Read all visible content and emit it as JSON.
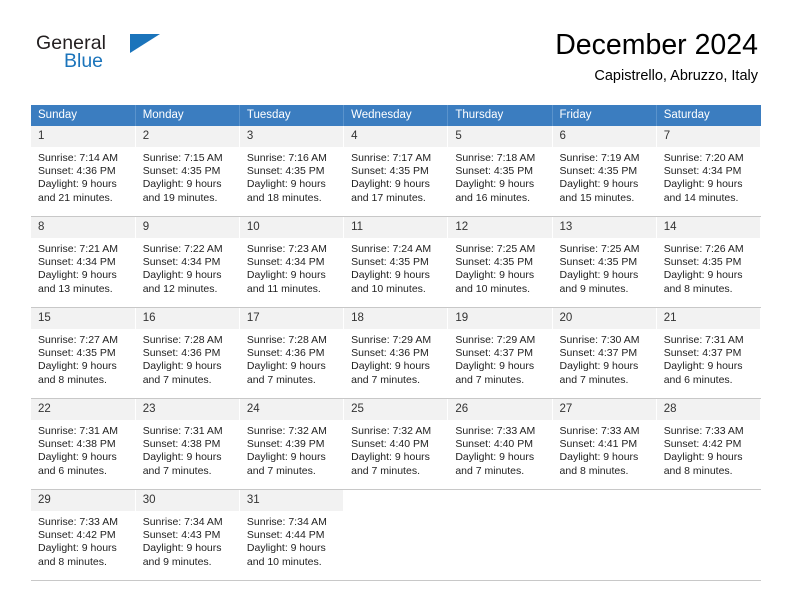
{
  "brand": {
    "name_part1": "General",
    "name_part2": "Blue",
    "triangle_color": "#1b74bb"
  },
  "header": {
    "title": "December 2024",
    "subtitle": "Capistrello, Abruzzo, Italy"
  },
  "theme": {
    "header_row_bg": "#3b7dc0",
    "header_row_text": "#ffffff",
    "daynum_bg": "#f2f2f2",
    "grid_line": "#c8c8c8"
  },
  "weekdays": [
    "Sunday",
    "Monday",
    "Tuesday",
    "Wednesday",
    "Thursday",
    "Friday",
    "Saturday"
  ],
  "weeks": [
    [
      {
        "day": "1",
        "sunrise": "Sunrise: 7:14 AM",
        "sunset": "Sunset: 4:36 PM",
        "daylight1": "Daylight: 9 hours",
        "daylight2": "and 21 minutes."
      },
      {
        "day": "2",
        "sunrise": "Sunrise: 7:15 AM",
        "sunset": "Sunset: 4:35 PM",
        "daylight1": "Daylight: 9 hours",
        "daylight2": "and 19 minutes."
      },
      {
        "day": "3",
        "sunrise": "Sunrise: 7:16 AM",
        "sunset": "Sunset: 4:35 PM",
        "daylight1": "Daylight: 9 hours",
        "daylight2": "and 18 minutes."
      },
      {
        "day": "4",
        "sunrise": "Sunrise: 7:17 AM",
        "sunset": "Sunset: 4:35 PM",
        "daylight1": "Daylight: 9 hours",
        "daylight2": "and 17 minutes."
      },
      {
        "day": "5",
        "sunrise": "Sunrise: 7:18 AM",
        "sunset": "Sunset: 4:35 PM",
        "daylight1": "Daylight: 9 hours",
        "daylight2": "and 16 minutes."
      },
      {
        "day": "6",
        "sunrise": "Sunrise: 7:19 AM",
        "sunset": "Sunset: 4:35 PM",
        "daylight1": "Daylight: 9 hours",
        "daylight2": "and 15 minutes."
      },
      {
        "day": "7",
        "sunrise": "Sunrise: 7:20 AM",
        "sunset": "Sunset: 4:34 PM",
        "daylight1": "Daylight: 9 hours",
        "daylight2": "and 14 minutes."
      }
    ],
    [
      {
        "day": "8",
        "sunrise": "Sunrise: 7:21 AM",
        "sunset": "Sunset: 4:34 PM",
        "daylight1": "Daylight: 9 hours",
        "daylight2": "and 13 minutes."
      },
      {
        "day": "9",
        "sunrise": "Sunrise: 7:22 AM",
        "sunset": "Sunset: 4:34 PM",
        "daylight1": "Daylight: 9 hours",
        "daylight2": "and 12 minutes."
      },
      {
        "day": "10",
        "sunrise": "Sunrise: 7:23 AM",
        "sunset": "Sunset: 4:34 PM",
        "daylight1": "Daylight: 9 hours",
        "daylight2": "and 11 minutes."
      },
      {
        "day": "11",
        "sunrise": "Sunrise: 7:24 AM",
        "sunset": "Sunset: 4:35 PM",
        "daylight1": "Daylight: 9 hours",
        "daylight2": "and 10 minutes."
      },
      {
        "day": "12",
        "sunrise": "Sunrise: 7:25 AM",
        "sunset": "Sunset: 4:35 PM",
        "daylight1": "Daylight: 9 hours",
        "daylight2": "and 10 minutes."
      },
      {
        "day": "13",
        "sunrise": "Sunrise: 7:25 AM",
        "sunset": "Sunset: 4:35 PM",
        "daylight1": "Daylight: 9 hours",
        "daylight2": "and 9 minutes."
      },
      {
        "day": "14",
        "sunrise": "Sunrise: 7:26 AM",
        "sunset": "Sunset: 4:35 PM",
        "daylight1": "Daylight: 9 hours",
        "daylight2": "and 8 minutes."
      }
    ],
    [
      {
        "day": "15",
        "sunrise": "Sunrise: 7:27 AM",
        "sunset": "Sunset: 4:35 PM",
        "daylight1": "Daylight: 9 hours",
        "daylight2": "and 8 minutes."
      },
      {
        "day": "16",
        "sunrise": "Sunrise: 7:28 AM",
        "sunset": "Sunset: 4:36 PM",
        "daylight1": "Daylight: 9 hours",
        "daylight2": "and 7 minutes."
      },
      {
        "day": "17",
        "sunrise": "Sunrise: 7:28 AM",
        "sunset": "Sunset: 4:36 PM",
        "daylight1": "Daylight: 9 hours",
        "daylight2": "and 7 minutes."
      },
      {
        "day": "18",
        "sunrise": "Sunrise: 7:29 AM",
        "sunset": "Sunset: 4:36 PM",
        "daylight1": "Daylight: 9 hours",
        "daylight2": "and 7 minutes."
      },
      {
        "day": "19",
        "sunrise": "Sunrise: 7:29 AM",
        "sunset": "Sunset: 4:37 PM",
        "daylight1": "Daylight: 9 hours",
        "daylight2": "and 7 minutes."
      },
      {
        "day": "20",
        "sunrise": "Sunrise: 7:30 AM",
        "sunset": "Sunset: 4:37 PM",
        "daylight1": "Daylight: 9 hours",
        "daylight2": "and 7 minutes."
      },
      {
        "day": "21",
        "sunrise": "Sunrise: 7:31 AM",
        "sunset": "Sunset: 4:37 PM",
        "daylight1": "Daylight: 9 hours",
        "daylight2": "and 6 minutes."
      }
    ],
    [
      {
        "day": "22",
        "sunrise": "Sunrise: 7:31 AM",
        "sunset": "Sunset: 4:38 PM",
        "daylight1": "Daylight: 9 hours",
        "daylight2": "and 6 minutes."
      },
      {
        "day": "23",
        "sunrise": "Sunrise: 7:31 AM",
        "sunset": "Sunset: 4:38 PM",
        "daylight1": "Daylight: 9 hours",
        "daylight2": "and 7 minutes."
      },
      {
        "day": "24",
        "sunrise": "Sunrise: 7:32 AM",
        "sunset": "Sunset: 4:39 PM",
        "daylight1": "Daylight: 9 hours",
        "daylight2": "and 7 minutes."
      },
      {
        "day": "25",
        "sunrise": "Sunrise: 7:32 AM",
        "sunset": "Sunset: 4:40 PM",
        "daylight1": "Daylight: 9 hours",
        "daylight2": "and 7 minutes."
      },
      {
        "day": "26",
        "sunrise": "Sunrise: 7:33 AM",
        "sunset": "Sunset: 4:40 PM",
        "daylight1": "Daylight: 9 hours",
        "daylight2": "and 7 minutes."
      },
      {
        "day": "27",
        "sunrise": "Sunrise: 7:33 AM",
        "sunset": "Sunset: 4:41 PM",
        "daylight1": "Daylight: 9 hours",
        "daylight2": "and 8 minutes."
      },
      {
        "day": "28",
        "sunrise": "Sunrise: 7:33 AM",
        "sunset": "Sunset: 4:42 PM",
        "daylight1": "Daylight: 9 hours",
        "daylight2": "and 8 minutes."
      }
    ],
    [
      {
        "day": "29",
        "sunrise": "Sunrise: 7:33 AM",
        "sunset": "Sunset: 4:42 PM",
        "daylight1": "Daylight: 9 hours",
        "daylight2": "and 8 minutes."
      },
      {
        "day": "30",
        "sunrise": "Sunrise: 7:34 AM",
        "sunset": "Sunset: 4:43 PM",
        "daylight1": "Daylight: 9 hours",
        "daylight2": "and 9 minutes."
      },
      {
        "day": "31",
        "sunrise": "Sunrise: 7:34 AM",
        "sunset": "Sunset: 4:44 PM",
        "daylight1": "Daylight: 9 hours",
        "daylight2": "and 10 minutes."
      },
      {
        "day": "",
        "sunrise": "",
        "sunset": "",
        "daylight1": "",
        "daylight2": ""
      },
      {
        "day": "",
        "sunrise": "",
        "sunset": "",
        "daylight1": "",
        "daylight2": ""
      },
      {
        "day": "",
        "sunrise": "",
        "sunset": "",
        "daylight1": "",
        "daylight2": ""
      },
      {
        "day": "",
        "sunrise": "",
        "sunset": "",
        "daylight1": "",
        "daylight2": ""
      }
    ]
  ]
}
